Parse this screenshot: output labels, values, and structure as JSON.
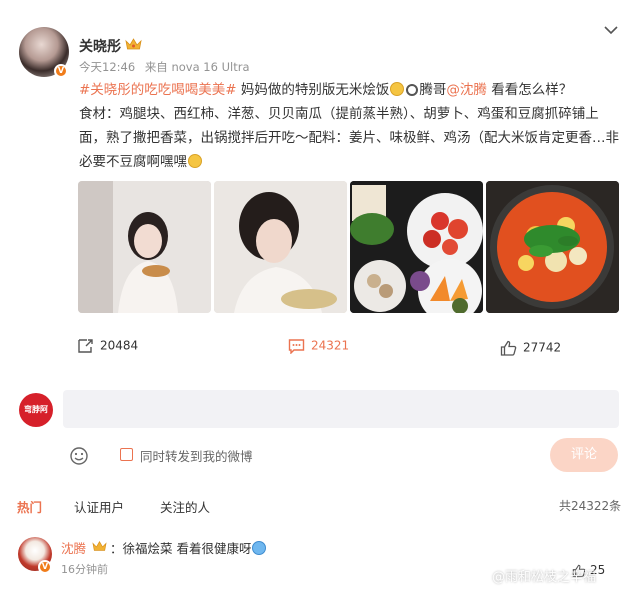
{
  "post": {
    "username": "关晓彤",
    "time": "今天12:46",
    "source": "来自 nova 16 Ultra",
    "hashtag": "#关晓彤的吃吃喝喝美美#",
    "line1_a": " 妈妈做的特别版无米烩饭",
    "line1_b": "腾哥",
    "mention": "@沈腾",
    "line1_c": " 看看怎么样？",
    "body": "食材：鸡腿块、西红柿、洋葱、贝贝南瓜（提前蒸半熟）、胡萝卜、鸡蛋和豆腐抓碎铺上面，熟了撒把香菜，出锅搅拌后开吃～配料：姜片、味极鲜、鸡汤（配大米饭肯定更香…非必要不豆腐啊嘿嘿",
    "images": [
      "photo-1",
      "photo-2",
      "photo-3",
      "photo-4"
    ]
  },
  "actions": {
    "repost_count": "20484",
    "comment_count": "24321",
    "like_count": "27742"
  },
  "composer": {
    "avatar_text": "弯脖阿",
    "sync_label": "同时转发到我的微博",
    "submit_label": "评论"
  },
  "filters": {
    "hot": "热门",
    "verified": "认证用户",
    "following": "关注的人",
    "total": "共24322条"
  },
  "top_comment": {
    "name": "沈腾",
    "text": "：徐福烩菜 看着很健康呀",
    "time": "16分钟前",
    "likes": "25"
  },
  "watermark": "@雨和松枝之辛福",
  "colors": {
    "accent": "#eb7350",
    "vip_orange": "#f07c1a",
    "submit_disabled": "#fbd5c6"
  },
  "icons": [
    "chevron-down-icon",
    "crown-icon",
    "repost-icon",
    "comment-icon",
    "like-icon",
    "emoji-icon",
    "weibo-logo-icon"
  ]
}
